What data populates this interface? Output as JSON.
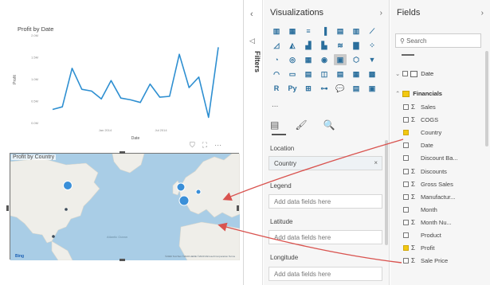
{
  "canvas": {
    "line_chart": {
      "title": "Profit by Date",
      "xlabel": "Date",
      "ylabel": "Profit",
      "y_ticks": [
        "2.0M",
        "1.5M",
        "1.0M",
        "0.5M",
        "0.0M"
      ],
      "x_ticks": [
        "Jan 2014",
        "Jul 2014"
      ]
    },
    "map": {
      "title": "Profit by Country",
      "attribution_left": "Bing",
      "attribution_right": "©2020 TomTom ©2020 HERE ©2020 Microsoft Corporation Terms",
      "ocean_label": "Atlantic Ocean"
    },
    "header_icons": [
      "filter-icon",
      "focus-mode-icon",
      "more-options-icon"
    ]
  },
  "filters": {
    "label": "Filters"
  },
  "visualizations": {
    "title": "Visualizations",
    "icons": [
      "stacked-bar",
      "stacked-column",
      "clustered-bar",
      "clustered-column",
      "100-bar",
      "100-column",
      "line",
      "area",
      "stacked-area",
      "line-column",
      "line-clustered",
      "ribbon",
      "waterfall",
      "scatter",
      "pie",
      "donut",
      "treemap",
      "map",
      "filled-map",
      "shape-map",
      "funnel",
      "gauge",
      "card",
      "multi-row-card",
      "kpi",
      "slicer",
      "table",
      "matrix",
      "r-visual",
      "python-visual",
      "key-influencers",
      "decomposition-tree",
      "qa",
      "smart-narrative",
      "custom-visual"
    ],
    "icon_glyphs": [
      "▥",
      "▦",
      "≡",
      "▐",
      "▤",
      "▥",
      "⟋",
      "◿",
      "◭",
      "▟",
      "▙",
      "≋",
      "▇",
      "⁘",
      "◔",
      "◎",
      "▦",
      "◉",
      "▣",
      "⬡",
      "▼",
      "◠",
      "▭",
      "▤",
      "◫",
      "▤",
      "▦",
      "▩",
      "R",
      "Py",
      "⊞",
      "⊶",
      "💬",
      "▤",
      "▣"
    ],
    "selected_icon_index": 18,
    "ellipsis": "...",
    "tabs": [
      "fields-tab-icon",
      "format-tab-icon",
      "analytics-tab-icon"
    ],
    "tab_glyphs": [
      "▤",
      "🖌",
      "🔍"
    ],
    "wells": [
      {
        "label": "Location",
        "value": "Country",
        "filled": true
      },
      {
        "label": "Legend",
        "value": "Add data fields here",
        "filled": false
      },
      {
        "label": "Latitude",
        "value": "Add data fields here",
        "filled": false
      },
      {
        "label": "Longitude",
        "value": "Add data fields here",
        "filled": false
      }
    ],
    "remove_glyph": "×"
  },
  "fields": {
    "title": "Fields",
    "search_placeholder": "Search",
    "date_table": "Date",
    "financials_table": "Financials",
    "items": [
      {
        "label": "Sales",
        "sigma": true,
        "checked": false
      },
      {
        "label": "COGS",
        "sigma": true,
        "checked": false
      },
      {
        "label": "Country",
        "sigma": false,
        "checked": true
      },
      {
        "label": "Date",
        "sigma": false,
        "checked": false
      },
      {
        "label": "Discount Ba...",
        "sigma": false,
        "checked": false
      },
      {
        "label": "Discounts",
        "sigma": true,
        "checked": false
      },
      {
        "label": "Gross Sales",
        "sigma": true,
        "checked": false
      },
      {
        "label": "Manufactur...",
        "sigma": true,
        "checked": false
      },
      {
        "label": "Month",
        "sigma": false,
        "checked": false
      },
      {
        "label": "Month Nu...",
        "sigma": true,
        "checked": false
      },
      {
        "label": "Product",
        "sigma": false,
        "checked": false
      },
      {
        "label": "Profit",
        "sigma": true,
        "checked": true
      },
      {
        "label": "Sale Price",
        "sigma": true,
        "checked": false
      }
    ]
  },
  "colors": {
    "line": "#2e8fd1",
    "annotation": "#d9534f",
    "map_water": "#a9cde6",
    "map_land": "#efeee9",
    "bubble": "#3a8fd8",
    "checkbox_checked": "#f2c811"
  }
}
